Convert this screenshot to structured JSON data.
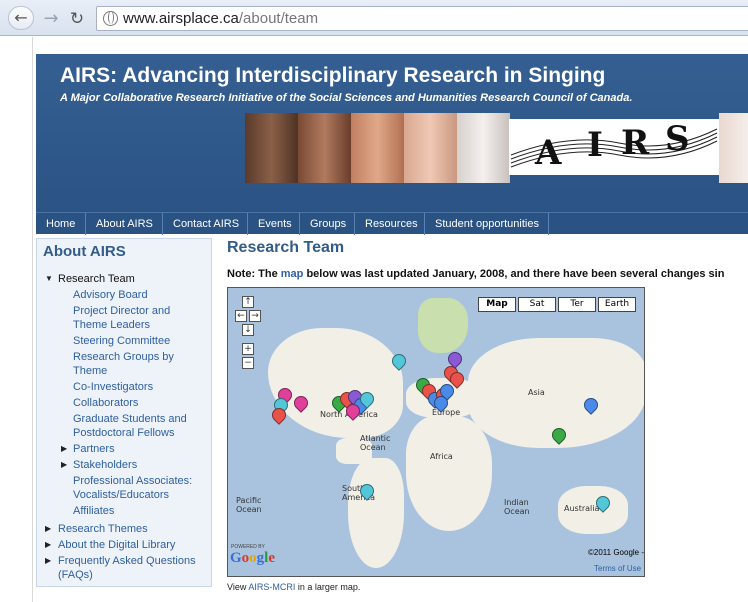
{
  "browser": {
    "url_host": "www.airsplace.ca",
    "url_path": "/about/team",
    "back_icon": "back-arrow-icon",
    "forward_icon": "forward-arrow-icon",
    "reload_icon": "reload-icon"
  },
  "header": {
    "title": "AIRS: Advancing Interdisciplinary Research in Singing",
    "subtitle": "A Major Collaborative Research Initiative of the Social Sciences and Humanities Research Council of Canada.",
    "logo_letters": [
      "A",
      "I",
      "R",
      "S"
    ]
  },
  "menu": {
    "items": [
      "Home",
      "About AIRS",
      "Contact AIRS",
      "Events",
      "Groups",
      "Resources",
      "Student opportunities"
    ]
  },
  "sidebar": {
    "title": "About AIRS",
    "current": "Research Team",
    "items": [
      "Advisory Board",
      "Project Director and Theme Leaders",
      "Steering Committee",
      "Research Groups by Theme",
      "Co-Investigators",
      "Collaborators",
      "Graduate Students and Postdoctoral Fellows",
      "Partners",
      "Stakeholders",
      "Professional Associates: Vocalists/Educators",
      "Affiliates"
    ],
    "footer_items": [
      "Research Themes",
      "About the Digital Library",
      "Frequently Asked Questions (FAQs)"
    ]
  },
  "main": {
    "title": "Research Team",
    "note_prefix": "Note: The ",
    "note_link": "map",
    "note_suffix": " below was last updated January, 2008, and there have been several changes sin",
    "map": {
      "types": [
        "Map",
        "Sat",
        "Ter",
        "Earth"
      ],
      "selected_type": "Map",
      "labels": {
        "north_america": "North America",
        "atlantic": "Atlantic Ocean",
        "europe": "Europe",
        "asia": "Asia",
        "africa": "Africa",
        "south_america": "South America",
        "pacific": "Pacific Ocean",
        "indian": "Indian Ocean",
        "australia": "Australia"
      },
      "copyright": "©2011 Google -",
      "terms": "Terms of Use",
      "powered_by": "POWERED BY",
      "google": "Google"
    },
    "view_prefix": "View ",
    "view_link": "AIRS-MCRI",
    "view_suffix": " in a larger map."
  },
  "colors": {
    "header_blue": "#2e5a8c",
    "link_blue": "#2e5fa0",
    "sidebar_bg": "#eef3fa",
    "ocean": "#a9c3df",
    "land": "#f2efe6"
  }
}
